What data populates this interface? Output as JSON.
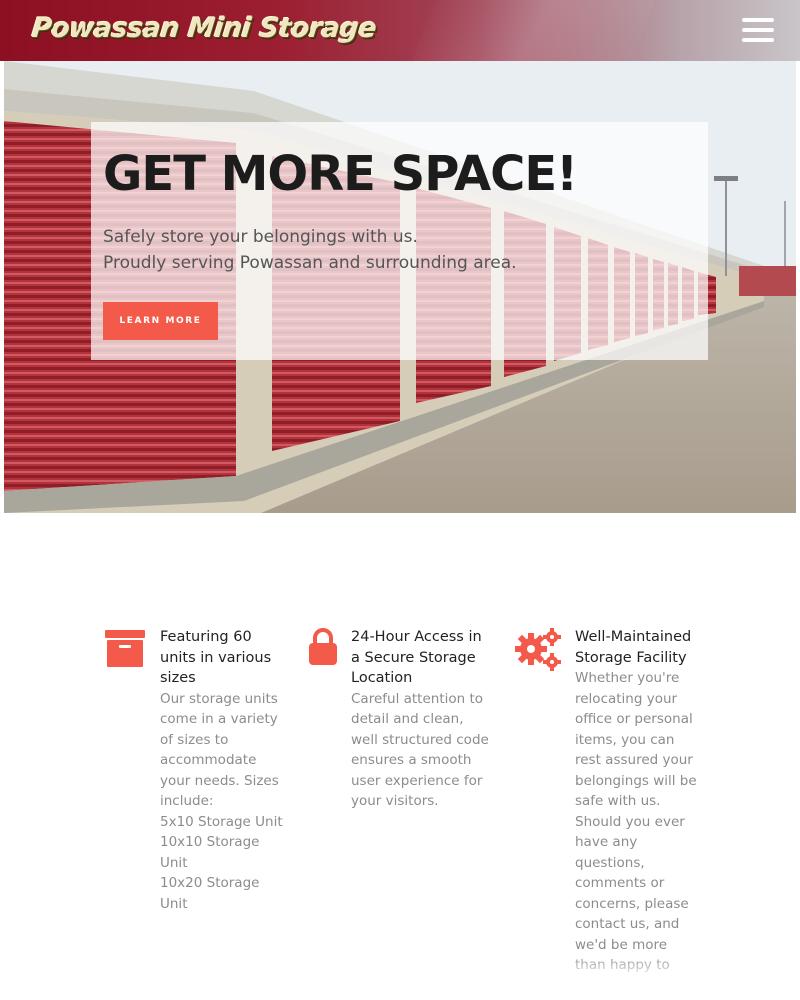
{
  "header": {
    "logo_text": "Powassan Mini Storage",
    "menu_icon": "hamburger-menu-icon"
  },
  "hero": {
    "title": "GET MORE SPACE!",
    "subtitle_lines": [
      "Safely store your belongings with us.",
      "Proudly serving Powassan and surrounding area."
    ],
    "button_label": "LEARN MORE"
  },
  "features": [
    {
      "icon": "storage-box-icon",
      "title": "Featuring 60 units in various sizes",
      "body_lines": [
        "Our storage units come in a variety of sizes to accommodate your needs. Sizes include:",
        "5x10 Storage Unit",
        "10x10 Storage Unit",
        "10x20 Storage Unit"
      ]
    },
    {
      "icon": "lock-icon",
      "title": "24-Hour Access in a Secure Storage Location",
      "body_lines": [
        "Careful attention to detail and clean, well structured code ensures a smooth user experience for your visitors."
      ]
    },
    {
      "icon": "gears-icon",
      "title": "Well-Maintained Storage Facility",
      "body_lines": [
        "Whether you're relocating your office or personal items, you can rest assured your belongings will be safe with us. Should you ever have any questions, comments or concerns, please contact us, and we'd be more than happy to provide"
      ]
    }
  ],
  "colors": {
    "accent": "#f45a4a",
    "header_red": "#8c0f22",
    "door_red": "#b8303a",
    "title_dark": "#1c1c1c",
    "body_gray": "#8c8c8c"
  }
}
